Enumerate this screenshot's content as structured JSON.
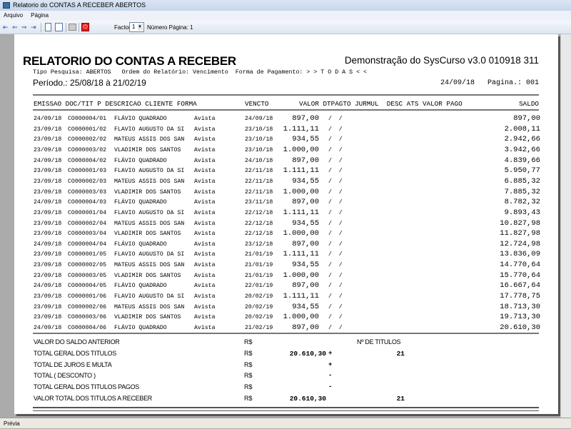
{
  "window": {
    "title": "Relatorio do CONTAS A RECEBER ABERTOS"
  },
  "menu": [
    "Arquivo",
    "Página"
  ],
  "toolbar": {
    "factor_label": "Factor:",
    "factor_value": "1",
    "page_label": "Número Página: 1",
    "exit_icon": "power-icon"
  },
  "report": {
    "title": "RELATORIO DO CONTAS A RECEBER",
    "company": "Demonstração do SysCurso v3.0 010918 311",
    "subtitle": "Tipo Pesquisa: ABERTOS   Ordem do Relatório: Vencimento  Forma de Pagamento: > > T O D A S < <",
    "periodo": "Período.: 25/08/18 à 21/02/19",
    "date_page": "24/09/18   Pagina.: 001",
    "columns_left": "EMISSAO DOC/TIT P DESCRICAO CLIENTE FORMA",
    "columns_vencto": "VENCTO",
    "columns_right": "VALOR DTPAGTO JURMUL  DESC ATS VALOR PAGO",
    "columns_saldo": "SALDO",
    "rows": [
      [
        "24/09/18",
        "CO000004/01",
        "FLÁVIO QUADRADO",
        "Avista",
        "24/09/18",
        "897,00",
        "/  /",
        "897,00"
      ],
      [
        "23/09/18",
        "CO000001/02",
        "FLAVIO AUGUSTO DA SI",
        "Avista",
        "23/10/18",
        "1.111,11",
        "/  /",
        "2.008,11"
      ],
      [
        "23/09/18",
        "CO000002/02",
        "MATEUS ASSIS DOS SAN",
        "Avista",
        "23/10/18",
        "934,55",
        "/  /",
        "2.942,66"
      ],
      [
        "23/09/18",
        "CO000003/02",
        "VLADIMIR DOS SANTOS",
        "Avista",
        "23/10/18",
        "1.000,00",
        "/  /",
        "3.942,66"
      ],
      [
        "24/09/18",
        "CO000004/02",
        "FLÁVIO QUADRADO",
        "Avista",
        "24/10/18",
        "897,00",
        "/  /",
        "4.839,66"
      ],
      [
        "23/09/18",
        "CO000001/03",
        "FLAVIO AUGUSTO DA SI",
        "Avista",
        "22/11/18",
        "1.111,11",
        "/  /",
        "5.950,77"
      ],
      [
        "23/09/18",
        "CO000002/03",
        "MATEUS ASSIS DOS SAN",
        "Avista",
        "22/11/18",
        "934,55",
        "/  /",
        "6.885,32"
      ],
      [
        "23/09/18",
        "CO000003/03",
        "VLADIMIR DOS SANTOS",
        "Avista",
        "22/11/18",
        "1.000,00",
        "/  /",
        "7.885,32"
      ],
      [
        "24/09/18",
        "CO000004/03",
        "FLÁVIO QUADRADO",
        "Avista",
        "23/11/18",
        "897,00",
        "/  /",
        "8.782,32"
      ],
      [
        "23/09/18",
        "CO000001/04",
        "FLAVIO AUGUSTO DA SI",
        "Avista",
        "22/12/18",
        "1.111,11",
        "/  /",
        "9.893,43"
      ],
      [
        "23/09/18",
        "CO000002/04",
        "MATEUS ASSIS DOS SAN",
        "Avista",
        "22/12/18",
        "934,55",
        "/  /",
        "10.827,98"
      ],
      [
        "23/09/18",
        "CO000003/04",
        "VLADIMIR DOS SANTOS",
        "Avista",
        "22/12/18",
        "1.000,00",
        "/  /",
        "11.827,98"
      ],
      [
        "24/09/18",
        "CO000004/04",
        "FLÁVIO QUADRADO",
        "Avista",
        "23/12/18",
        "897,00",
        "/  /",
        "12.724,98"
      ],
      [
        "23/09/18",
        "CO000001/05",
        "FLAVIO AUGUSTO DA SI",
        "Avista",
        "21/01/19",
        "1.111,11",
        "/  /",
        "13.836,09"
      ],
      [
        "23/09/18",
        "CO000002/05",
        "MATEUS ASSIS DOS SAN",
        "Avista",
        "21/01/19",
        "934,55",
        "/  /",
        "14.770,64"
      ],
      [
        "23/09/18",
        "CO000003/05",
        "VLADIMIR DOS SANTOS",
        "Avista",
        "21/01/19",
        "1.000,00",
        "/  /",
        "15.770,64"
      ],
      [
        "24/09/18",
        "CO000004/05",
        "FLÁVIO QUADRADO",
        "Avista",
        "22/01/19",
        "897,00",
        "/  /",
        "16.667,64"
      ],
      [
        "23/09/18",
        "CO000001/06",
        "FLAVIO AUGUSTO DA SI",
        "Avista",
        "20/02/19",
        "1.111,11",
        "/  /",
        "17.778,75"
      ],
      [
        "23/09/18",
        "CO000002/06",
        "MATEUS ASSIS DOS SAN",
        "Avista",
        "20/02/19",
        "934,55",
        "/  /",
        "18.713,30"
      ],
      [
        "23/09/18",
        "CO000003/06",
        "VLADIMIR DOS SANTOS",
        "Avista",
        "20/02/19",
        "1.000,00",
        "/  /",
        "19.713,30"
      ],
      [
        "24/09/18",
        "CO000004/06",
        "FLÁVIO QUADRADO",
        "Avista",
        "21/02/19",
        "897,00",
        "/  /",
        "20.610,30"
      ]
    ],
    "totals": [
      {
        "label": "VALOR DO SALDO ANTERIOR",
        "currency": "R$",
        "value": "",
        "sign": "",
        "count": "Nº DE TITULOS"
      },
      {
        "label": "TOTAL GERAL DOS TITULOS",
        "currency": "R$",
        "value": "20.610,30",
        "sign": "+",
        "count": "21"
      },
      {
        "label": "TOTAL DE JUROS E MULTA",
        "currency": "R$",
        "value": "",
        "sign": "+",
        "count": ""
      },
      {
        "label": "TOTAL ( DESCONTO )",
        "currency": "R$",
        "value": "",
        "sign": "-",
        "count": ""
      },
      {
        "label": "TOTAL GERAL DOS TITULOS PAGOS",
        "currency": "R$",
        "value": "",
        "sign": "-",
        "count": ""
      },
      {
        "label": "VALOR TOTAL DOS TITULOS A RECEBER",
        "currency": "R$",
        "value": "20.610,30",
        "sign": "",
        "count": "21"
      }
    ]
  },
  "status": "Prévia"
}
